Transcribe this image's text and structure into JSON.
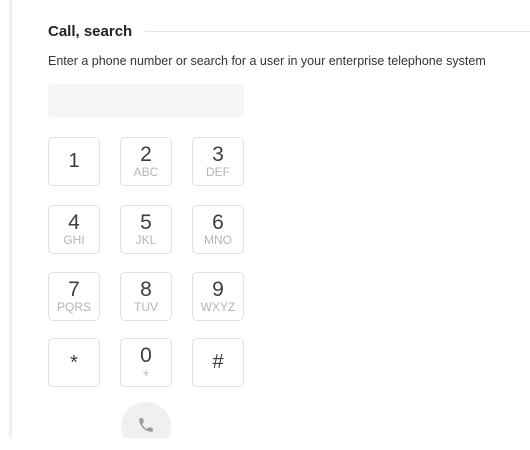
{
  "header": {
    "title": "Call, search"
  },
  "description": "Enter a phone number or search for a user in your enterprise telephone system",
  "search": {
    "value": "",
    "placeholder": ""
  },
  "keypad": [
    {
      "digit": "1",
      "letters": ""
    },
    {
      "digit": "2",
      "letters": "ABC"
    },
    {
      "digit": "3",
      "letters": "DEF"
    },
    {
      "digit": "4",
      "letters": "GHI"
    },
    {
      "digit": "5",
      "letters": "JKL"
    },
    {
      "digit": "6",
      "letters": "MNO"
    },
    {
      "digit": "7",
      "letters": "PQRS"
    },
    {
      "digit": "8",
      "letters": "TUV"
    },
    {
      "digit": "9",
      "letters": "WXYZ"
    },
    {
      "digit": "*",
      "letters": ""
    },
    {
      "digit": "0",
      "letters": "+"
    },
    {
      "digit": "#",
      "letters": ""
    }
  ],
  "call_button": {
    "icon": "phone-icon"
  }
}
